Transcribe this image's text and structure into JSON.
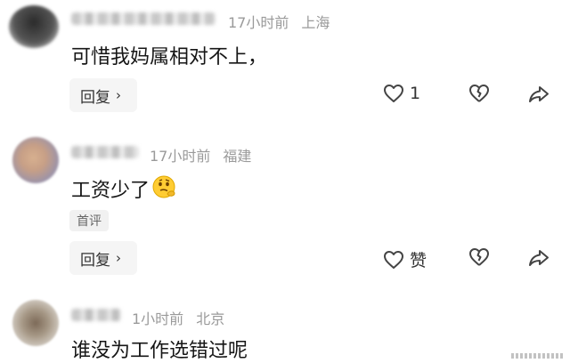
{
  "comments": [
    {
      "time": "17小时前",
      "location": "上海",
      "text": "可惜我妈属相对不上，",
      "reply_label": "回复",
      "like_count": "1"
    },
    {
      "time": "17小时前",
      "location": "福建",
      "text": "工资少了",
      "badge": "首评",
      "reply_label": "回复",
      "like_label": "赞"
    },
    {
      "time": "1小时前",
      "location": "北京",
      "text": "谁没为工作选错过呢"
    }
  ],
  "icons": {
    "like": "heart-icon",
    "dislike": "broken-heart-icon",
    "share": "share-arrow-icon",
    "chevron": "chevron-right-icon",
    "emoji": "thinking-face-emoji"
  }
}
